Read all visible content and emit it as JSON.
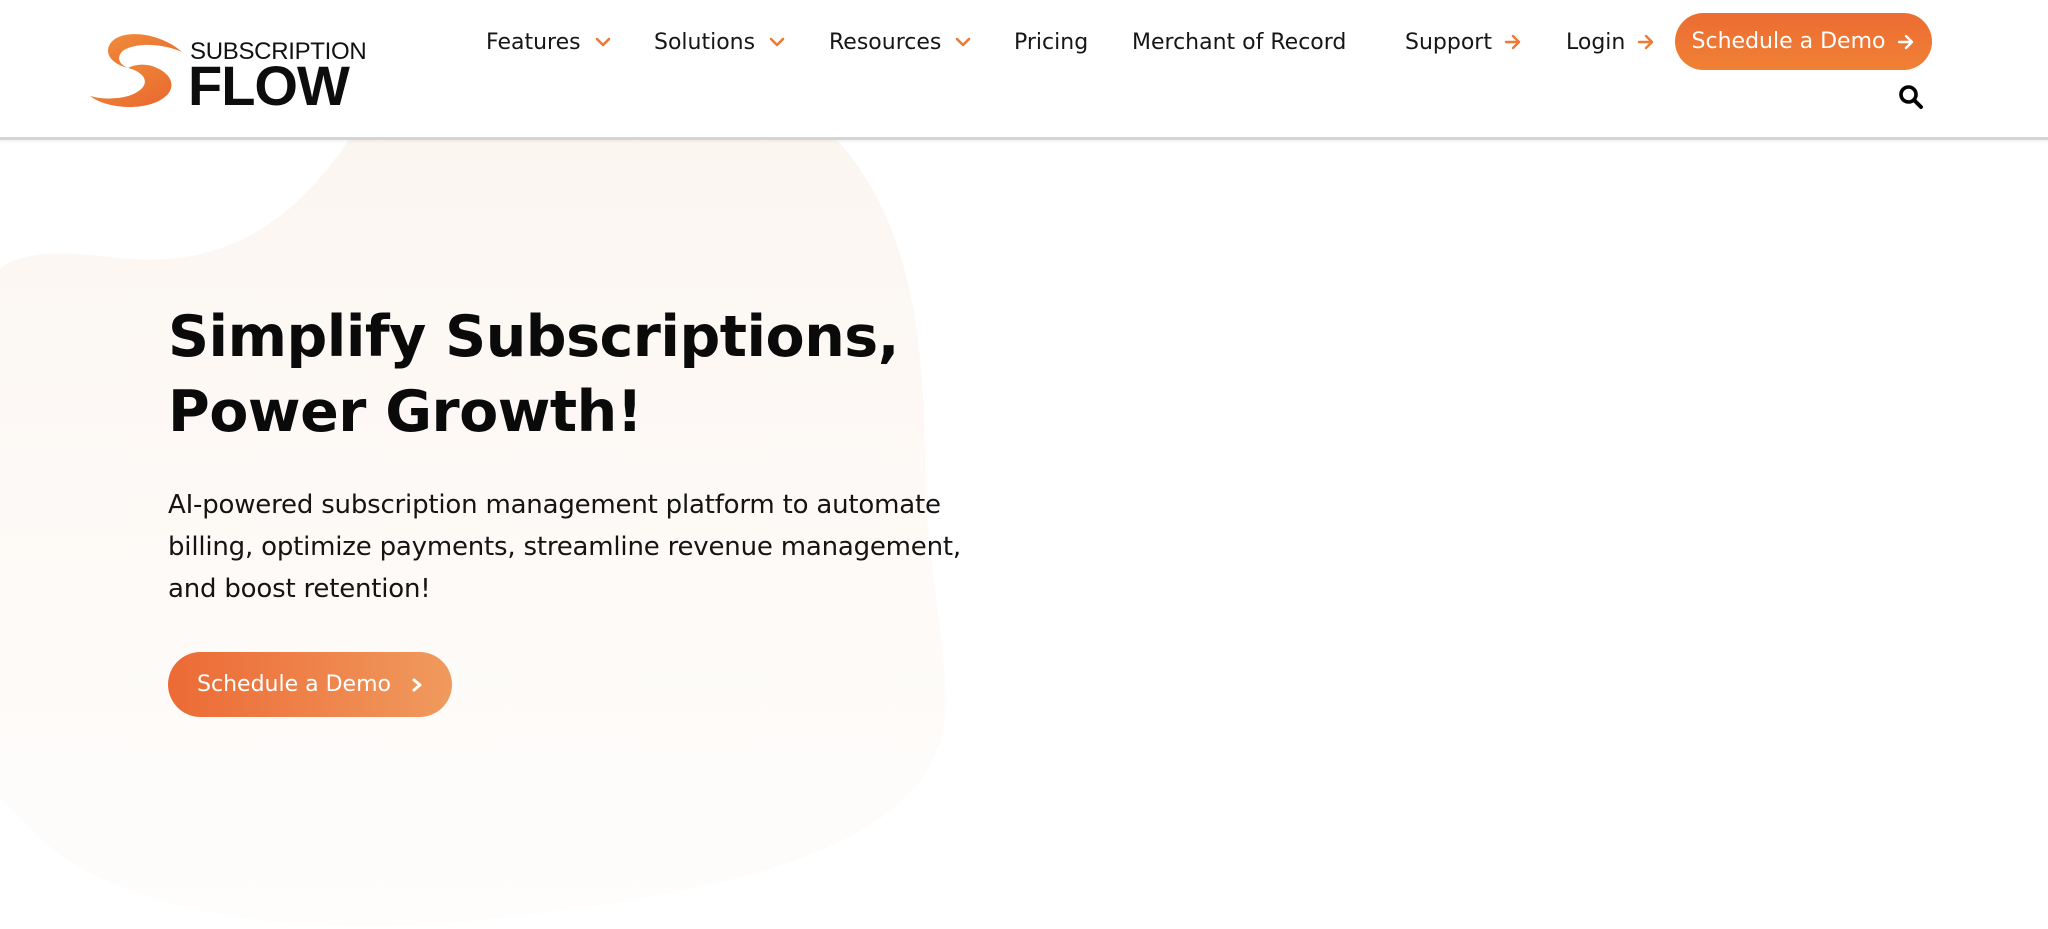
{
  "brand": {
    "name_top": "SUBSCRIPTION",
    "name_bottom": "FLOW",
    "accent_color": "#ec6c33",
    "accent_light": "#f09a5e",
    "blob_color": "#fdf8f4"
  },
  "nav": {
    "items": [
      {
        "label": "Features",
        "icon": "chevron-down-icon"
      },
      {
        "label": "Solutions",
        "icon": "chevron-down-icon"
      },
      {
        "label": "Resources",
        "icon": "chevron-down-icon"
      },
      {
        "label": "Pricing"
      },
      {
        "label": "Merchant of Record"
      }
    ],
    "support_label": "Support",
    "login_label": "Login",
    "demo_label": "Schedule a Demo",
    "search_icon": "search-icon"
  },
  "hero": {
    "title_line1": "Simplify Subscriptions,",
    "title_line2": "Power Growth!",
    "subtitle": "AI-powered subscription management platform to automate billing, optimize payments, streamline revenue management, and boost retention!",
    "cta_label": "Schedule a Demo"
  }
}
